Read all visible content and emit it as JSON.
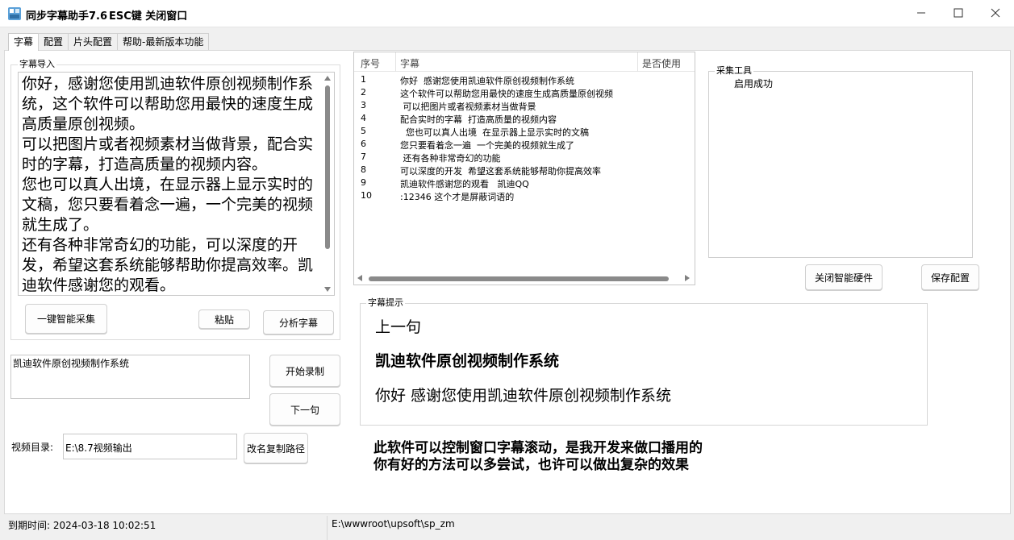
{
  "window": {
    "title": "同步字幕助手7.6",
    "hint": "ESC键 关闭窗口",
    "icon": "app-icon",
    "controls": [
      "minimize-icon",
      "maximize-icon",
      "close-icon"
    ]
  },
  "tabs": [
    {
      "label": "字幕",
      "active": true
    },
    {
      "label": "配置",
      "active": false
    },
    {
      "label": "片头配置",
      "active": false
    },
    {
      "label": "帮助-最新版本功能",
      "active": false
    }
  ],
  "subtitle_import": {
    "group_label": "字幕导入",
    "text": "你好，感谢您使用凯迪软件原创视频制作系统，这个软件可以帮助您用最快的速度生成高质量原创视频。\n可以把图片或者视频素材当做背景，配合实时的字幕，打造高质量的视频内容。\n您也可以真人出境，在显示器上显示实时的文稿，您只要看着念一遍，一个完美的视频就生成了。\n还有各种非常奇幻的功能，可以深度的开发，希望这套系统能够帮助你提高效率。凯迪软件感谢您的观看。",
    "buttons": {
      "auto_collect": "一键智能采集",
      "paste": "粘贴",
      "analyze": "分析字幕"
    }
  },
  "current_subtitle_value": "凯迪软件原创视频制作系统",
  "record_buttons": {
    "start": "开始录制",
    "next": "下一句"
  },
  "video_dir": {
    "label": "视频目录:",
    "value": "E:\\8.7视频输出",
    "button": "改名复制路径"
  },
  "table": {
    "headers": [
      "序号",
      "字幕",
      "是否使用"
    ],
    "rows": [
      {
        "no": "1",
        "text": "你好  感谢您使用凯迪软件原创视频制作系统"
      },
      {
        "no": "2",
        "text": "这个软件可以帮助您用最快的速度生成高质量原创视频"
      },
      {
        "no": "3",
        "text": " 可以把图片或者视频素材当做背景"
      },
      {
        "no": "4",
        "text": "配合实时的字幕  打造高质量的视频内容"
      },
      {
        "no": "5",
        "text": "  您也可以真人出境  在显示器上显示实时的文稿"
      },
      {
        "no": "6",
        "text": "您只要看着念一遍  一个完美的视频就生成了"
      },
      {
        "no": "7",
        "text": " 还有各种非常奇幻的功能"
      },
      {
        "no": "8",
        "text": "可以深度的开发  希望这套系统能够帮助你提高效率"
      },
      {
        "no": "9",
        "text": "凯迪软件感谢您的观看   凯迪QQ"
      },
      {
        "no": "10",
        "text": ":12346 这个才是屏蔽词语的"
      }
    ]
  },
  "collect_tool": {
    "group_label": "采集工具",
    "status": "启用成功"
  },
  "right_buttons": {
    "close_hardware": "关闭智能硬件",
    "save_config": "保存配置"
  },
  "subtitle_hint": {
    "group_label": "字幕提示",
    "prev_label": "上一句",
    "current": "凯迪软件原创视频制作系统",
    "next": "你好  感谢您使用凯迪软件原创视频制作系统"
  },
  "notes": [
    "此软件可以控制窗口字幕滚动，是我开发来做口播用的",
    "你有好的方法可以多尝试，也许可以做出复杂的效果"
  ],
  "status": {
    "expire": "到期时间:  2024-03-18 10:02:51",
    "path": "E:\\wwwroot\\upsoft\\sp_zm"
  }
}
